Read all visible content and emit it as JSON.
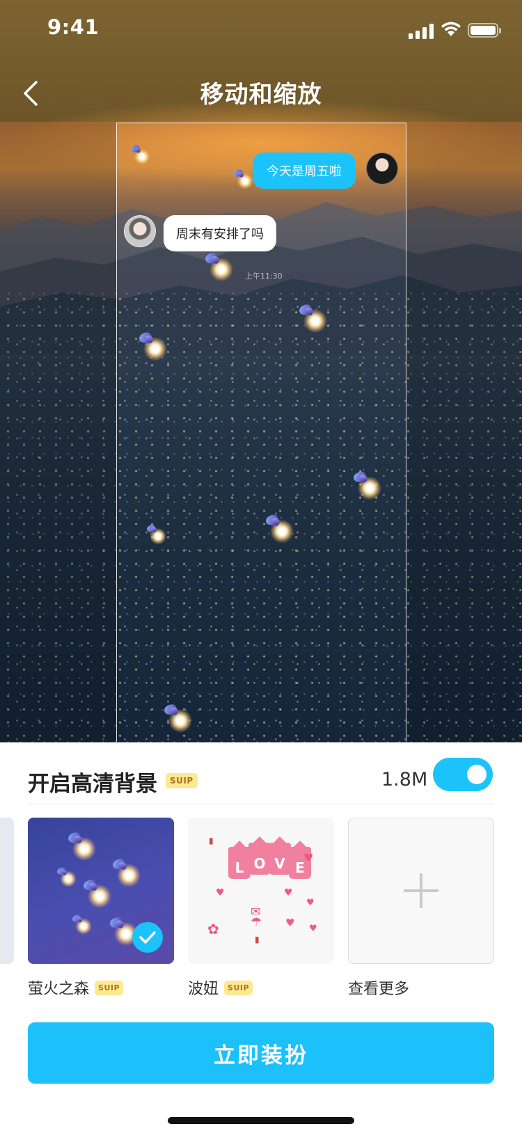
{
  "status_bar": {
    "time": "9:41"
  },
  "nav": {
    "title": "移动和缩放"
  },
  "chat_preview": {
    "my_message": "今天是周五啦",
    "other_message": "周末有安排了吗",
    "timestamp": "上午11:30"
  },
  "hd_background": {
    "label": "开启高清背景",
    "badge": "SUIP",
    "size": "1.8M",
    "enabled": true
  },
  "themes": [
    {
      "name": "萤火之森",
      "badge": "SUIP",
      "selected": true
    },
    {
      "name": "波妞",
      "badge": "SUIP",
      "selected": false,
      "tag_letters": [
        "L",
        "O",
        "V",
        "E"
      ]
    },
    {
      "name": "查看更多",
      "badge": "",
      "selected": false
    }
  ],
  "cta": {
    "label": "立即装扮"
  },
  "colors": {
    "accent": "#1CC3FB",
    "vip_badge": "#FDE993",
    "vip_text": "#A9741C"
  }
}
